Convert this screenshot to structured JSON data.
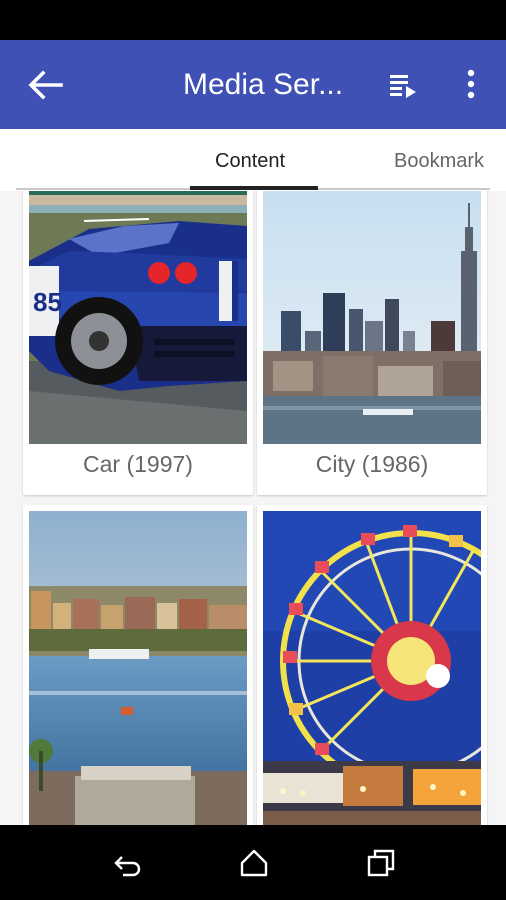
{
  "app_bar": {
    "title": "Media Ser...",
    "back_icon": "arrow-back-icon",
    "queue_icon": "playlist-icon",
    "more_icon": "more-vert-icon",
    "color": "#3f51b5"
  },
  "tabs": [
    {
      "label": "Content",
      "selected": true
    },
    {
      "label": "Bookmark",
      "selected": false
    }
  ],
  "items": [
    {
      "caption": "Car (1997)",
      "image": "blue-sports-car"
    },
    {
      "caption": "City (1986)",
      "image": "city-skyline"
    },
    {
      "caption": "",
      "image": "harbor-city"
    },
    {
      "caption": "",
      "image": "ferris-wheel"
    }
  ],
  "nav_bar": {
    "back_icon": "nav-back-icon",
    "home_icon": "home-icon",
    "recents_icon": "recents-icon"
  }
}
